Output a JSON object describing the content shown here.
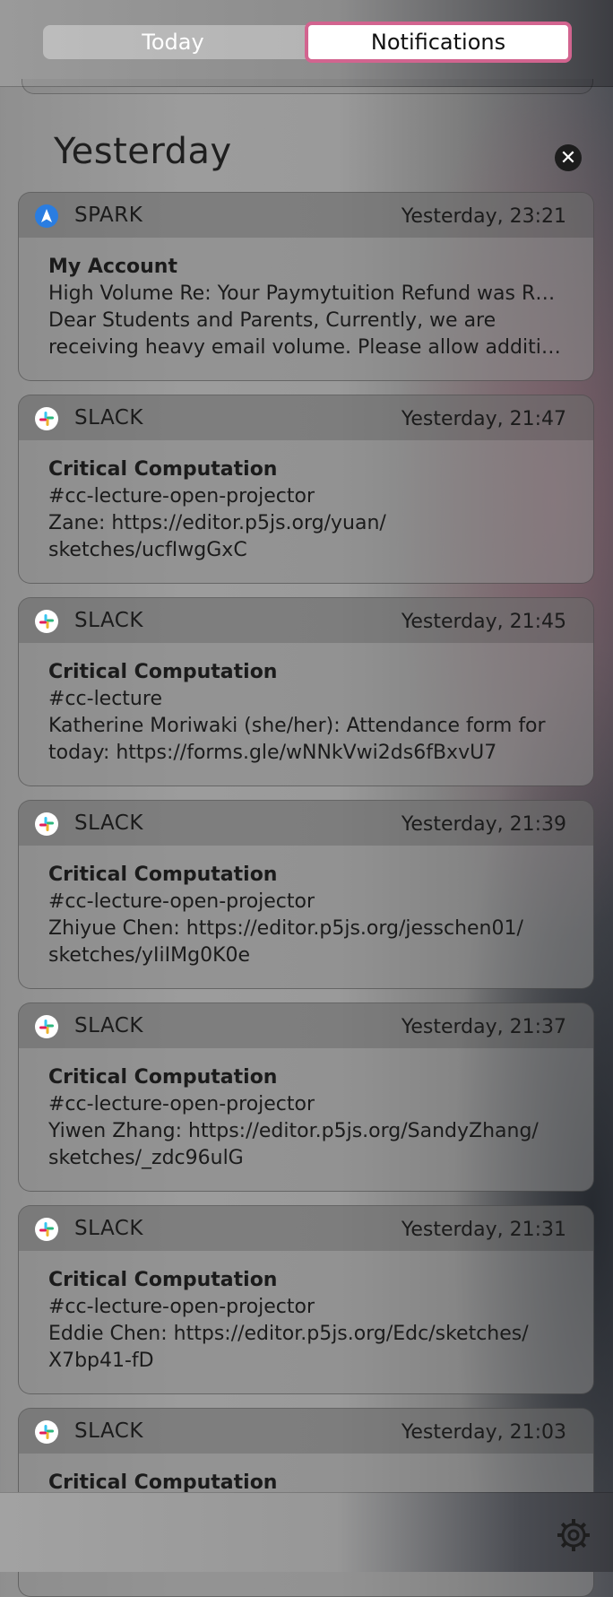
{
  "tabs": {
    "today": "Today",
    "notifications": "Notifications"
  },
  "section": {
    "title": "Yesterday",
    "clear_icon": "close-icon"
  },
  "notifications": [
    {
      "app": "SPARK",
      "icon": "spark-icon",
      "time": "Yesterday, 23:21",
      "title": "My Account",
      "lines": [
        "High Volume Re: Your Paymytuition Refund was R…",
        "Dear Students and Parents, Currently, we are",
        "receiving heavy email volume. Please allow additi…"
      ]
    },
    {
      "app": "SLACK",
      "icon": "slack-icon",
      "time": "Yesterday, 21:47",
      "title": "Critical Computation",
      "lines": [
        "#cc-lecture-open-projector",
        "Zane: https://editor.p5js.org/yuan/",
        "sketches/ucfIwgGxC"
      ]
    },
    {
      "app": "SLACK",
      "icon": "slack-icon",
      "time": "Yesterday, 21:45",
      "title": "Critical Computation",
      "lines": [
        "#cc-lecture",
        "Katherine Moriwaki (she/her): Attendance form for",
        "today: https://forms.gle/wNNkVwi2ds6fBxvU7"
      ]
    },
    {
      "app": "SLACK",
      "icon": "slack-icon",
      "time": "Yesterday, 21:39",
      "title": "Critical Computation",
      "lines": [
        "#cc-lecture-open-projector",
        "Zhiyue Chen: https://editor.p5js.org/jesschen01/",
        "sketches/yIiIMg0K0e"
      ]
    },
    {
      "app": "SLACK",
      "icon": "slack-icon",
      "time": "Yesterday, 21:37",
      "title": "Critical Computation",
      "lines": [
        "#cc-lecture-open-projector",
        "Yiwen Zhang: https://editor.p5js.org/SandyZhang/",
        "sketches/_zdc96ulG"
      ]
    },
    {
      "app": "SLACK",
      "icon": "slack-icon",
      "time": "Yesterday, 21:31",
      "title": "Critical Computation",
      "lines": [
        "#cc-lecture-open-projector",
        "Eddie Chen: https://editor.p5js.org/Edc/sketches/",
        "X7bp41-fD"
      ]
    },
    {
      "app": "SLACK",
      "icon": "slack-icon",
      "time": "Yesterday, 21:03",
      "title": "Critical Computation",
      "lines": []
    }
  ],
  "footer": {
    "settings_icon": "gear-icon"
  }
}
